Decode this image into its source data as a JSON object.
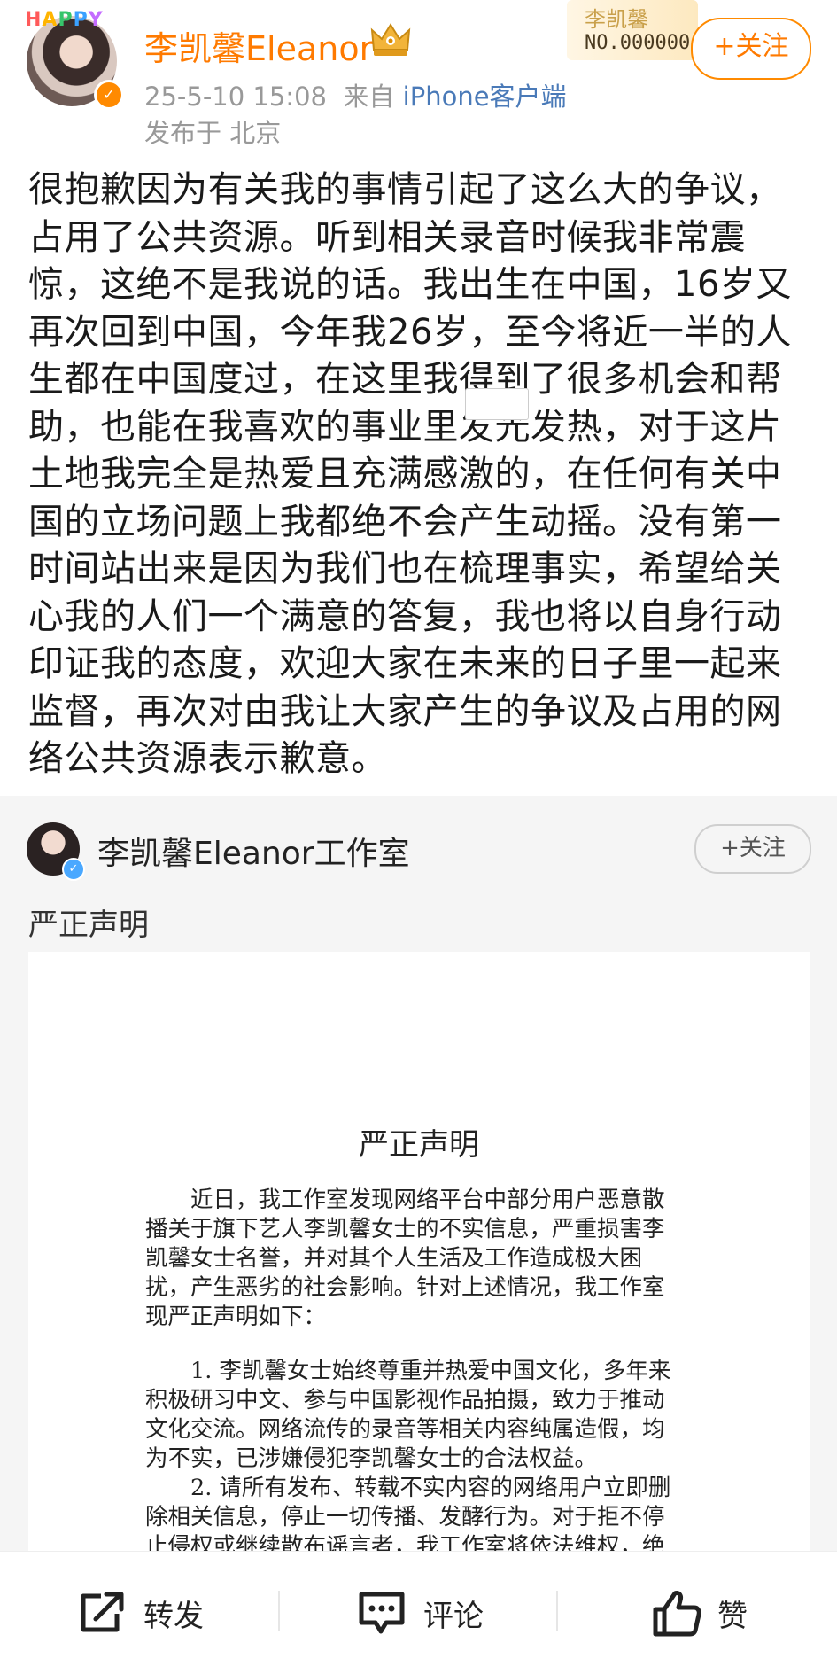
{
  "header": {
    "avatar_sticker": [
      "H",
      "A",
      "P",
      "P",
      "Y"
    ],
    "username": "李凯馨Eleanor",
    "fan_badge": {
      "name": "李凯馨",
      "number": "NO.000000"
    },
    "follow_label": "+关注",
    "timestamp": "25-5-10 15:08",
    "source_prefix": "来自",
    "source_client": "iPhone客户端",
    "location": "发布于 北京"
  },
  "post": {
    "lines": [
      "很抱歉因为有关我的事情引起了这么大的争议，",
      "占用了公共资源。听到相关录音时候我非常震",
      "惊，这绝不是我说的话。我出生在中国，16岁又",
      "再次回到中国，今年我26岁，至今将近一半的人",
      "生都在中国度过，在这里我得到了很多机会和帮",
      "助，也能在我喜欢的事业里发光发热，对于这片",
      "土地我完全是热爱且充满感激的，在任何有关中",
      "国的立场问题上我都绝不会产生动摇。没有第一",
      "时间站出来是因为我们也在梳理事实，希望给关",
      "心我的人们一个满意的答复，我也将以自身行动",
      "印证我的态度，欢迎大家在未来的日子里一起来",
      "监督，再次对由我让大家产生的争议及占用的网",
      "络公共资源表示歉意。"
    ]
  },
  "repost": {
    "author": "李凯馨Eleanor工作室",
    "follow_label": "+关注",
    "title": "严正声明",
    "document": {
      "title": "严正声明",
      "paragraphs": [
        {
          "style": "indent",
          "lines": [
            "近日，我工作室发现网络平台中部分用户恶意散",
            "播关于旗下艺人李凯馨女士的不实信息，严重损害李",
            "凯馨女士名誉，并对其个人生活及工作造成极大困",
            "扰，产生恶劣的社会影响。针对上述情况，我工作室",
            "现严正声明如下："
          ]
        },
        {
          "style": "gap",
          "lines": []
        },
        {
          "style": "indent",
          "lines": [
            "1. 李凯馨女士始终尊重并热爱中国文化，多年来",
            "积极研习中文、参与中国影视作品拍摄，致力于推动",
            "文化交流。网络流传的录音等相关内容纯属造假，均",
            "为不实，已涉嫌侵犯李凯馨女士的合法权益。"
          ]
        },
        {
          "style": "indent",
          "lines": [
            "2. 请所有发布、转载不实内容的网络用户立即删",
            "除相关信息，停止一切传播、发酵行为。对于拒不停",
            "止侵权或继续散布谣言者，我工作室将依法维权，绝"
          ]
        }
      ]
    }
  },
  "actions": {
    "repost_label": "转发",
    "comment_label": "评论",
    "like_label": "赞"
  },
  "colors": {
    "username": "#ff7a00",
    "follow_border": "#ff8a00",
    "client_link": "#4a7ab8",
    "meta_gray": "#999999",
    "repost_bg": "#f5f5f5"
  }
}
